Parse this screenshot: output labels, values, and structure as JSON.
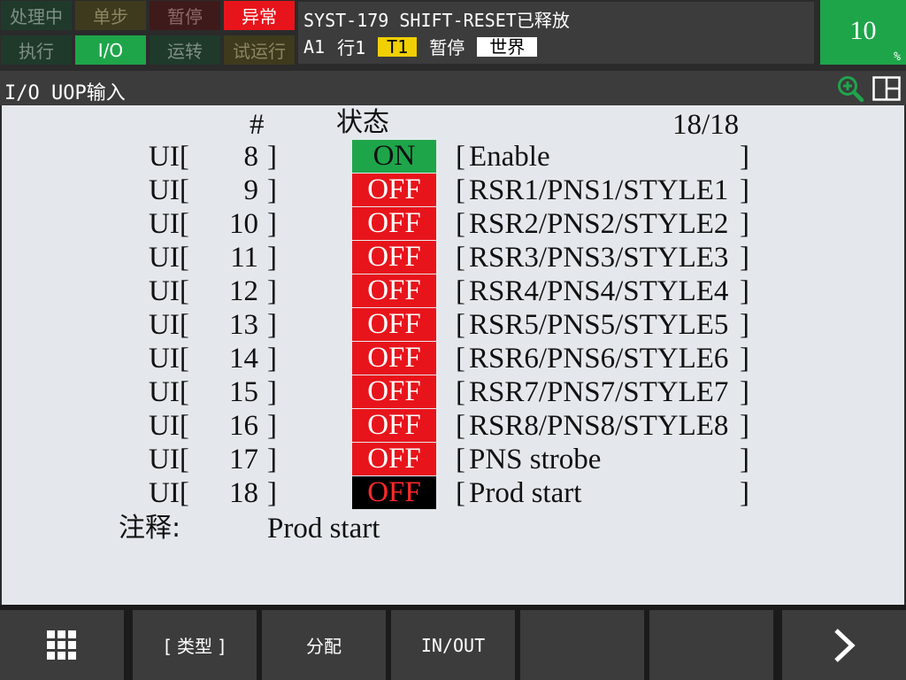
{
  "status_buttons": [
    {
      "label": "处理中",
      "style": "dk"
    },
    {
      "label": "单步",
      "style": "ol"
    },
    {
      "label": "暂停",
      "style": "mr"
    },
    {
      "label": "异常",
      "style": "red"
    },
    {
      "label": "执行",
      "style": "dk"
    },
    {
      "label": "I/O",
      "style": "grn"
    },
    {
      "label": "运转",
      "style": "dk"
    },
    {
      "label": "试运行",
      "style": "ol"
    }
  ],
  "message": {
    "line1": "SYST-179 SHIFT-RESET已释放",
    "group": "A1",
    "line": "行1",
    "tool": "T1",
    "state": "暂停",
    "coord": "世界"
  },
  "override": {
    "value": "10",
    "unit": "%"
  },
  "title": "I/O UOP输入",
  "icons": {
    "zoom": "zoom-in-icon",
    "split": "split-window-icon",
    "menu": "grid-menu-icon",
    "next": "chevron-right-icon"
  },
  "table": {
    "col_num": "#",
    "col_status": "状态",
    "page": "18/18",
    "rows": [
      {
        "prefix": "UI[",
        "num": "8",
        "close": "]",
        "state": "ON",
        "style": "on",
        "desc": "Enable"
      },
      {
        "prefix": "UI[",
        "num": "9",
        "close": "]",
        "state": "OFF",
        "style": "off",
        "desc": "RSR1/PNS1/STYLE1"
      },
      {
        "prefix": "UI[",
        "num": "10",
        "close": "]",
        "state": "OFF",
        "style": "off",
        "desc": "RSR2/PNS2/STYLE2"
      },
      {
        "prefix": "UI[",
        "num": "11",
        "close": "]",
        "state": "OFF",
        "style": "off",
        "desc": "RSR3/PNS3/STYLE3"
      },
      {
        "prefix": "UI[",
        "num": "12",
        "close": "]",
        "state": "OFF",
        "style": "off",
        "desc": "RSR4/PNS4/STYLE4"
      },
      {
        "prefix": "UI[",
        "num": "13",
        "close": "]",
        "state": "OFF",
        "style": "off",
        "desc": "RSR5/PNS5/STYLE5"
      },
      {
        "prefix": "UI[",
        "num": "14",
        "close": "]",
        "state": "OFF",
        "style": "off",
        "desc": "RSR6/PNS6/STYLE6"
      },
      {
        "prefix": "UI[",
        "num": "15",
        "close": "]",
        "state": "OFF",
        "style": "off",
        "desc": "RSR7/PNS7/STYLE7"
      },
      {
        "prefix": "UI[",
        "num": "16",
        "close": "]",
        "state": "OFF",
        "style": "off",
        "desc": "RSR8/PNS8/STYLE8"
      },
      {
        "prefix": "UI[",
        "num": "17",
        "close": "]",
        "state": "OFF",
        "style": "off",
        "desc": "PNS strobe"
      },
      {
        "prefix": "UI[",
        "num": "18",
        "close": "]",
        "state": "OFF",
        "style": "sel",
        "desc": "Prod start"
      }
    ]
  },
  "comment": {
    "label": "注释:",
    "value": "Prod start"
  },
  "function_keys": {
    "type": "[ 类型 ]",
    "config": "分配",
    "inout": "IN/OUT"
  }
}
